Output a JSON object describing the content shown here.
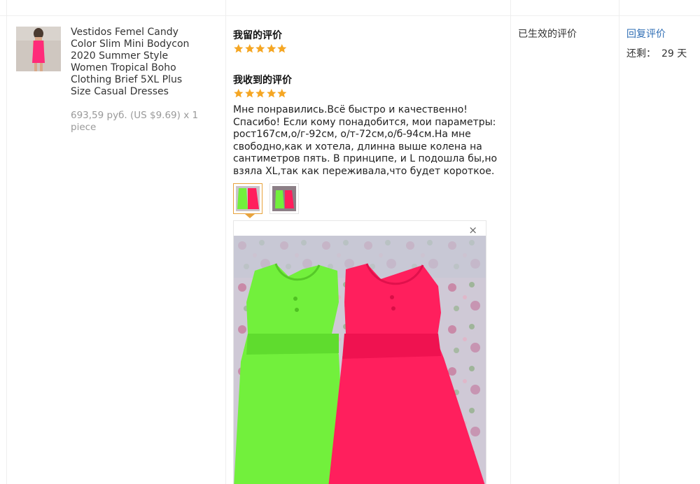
{
  "product": {
    "title": "Vestidos Femel Candy Color Slim Mini Bodycon 2020 Summer Style Women Tropical Boho Clothing Brief 5XL Plus Size Casual Dresses",
    "price": "693,59 руб. (US $9.69) x 1 piece",
    "thumbnail_icon": "dress-photo"
  },
  "my_review": {
    "title": "我留的评价",
    "rating": 5
  },
  "received_review": {
    "title": "我收到的评价",
    "rating": 5,
    "text": "Мне понравились.Всё быстро и качественно!Спасибо! Если кому понадобится, мои параметры: рост167см,о/г-92см, о/т-72см,о/б-94см.На мне свободно,как и хотела, длинна выше колена на сантиметров пять. В принципе, и L подошла бы,но взяла XL,так как переживала,что будет короткое.",
    "photos": [
      "green-and-pink-dresses-photo",
      "green-and-pink-dresses-photo"
    ],
    "close_icon": "×"
  },
  "status": {
    "label": "已生效的评价"
  },
  "actions": {
    "reply_label": "回复评价",
    "remaining_label": "还剩：",
    "remaining_value": "29 天"
  },
  "colors": {
    "star": "#f5a623",
    "link": "#2e6db4",
    "active_thumb_border": "#e8a33d",
    "dress_green": "#72f03c",
    "dress_pink": "#ff1f5d"
  }
}
